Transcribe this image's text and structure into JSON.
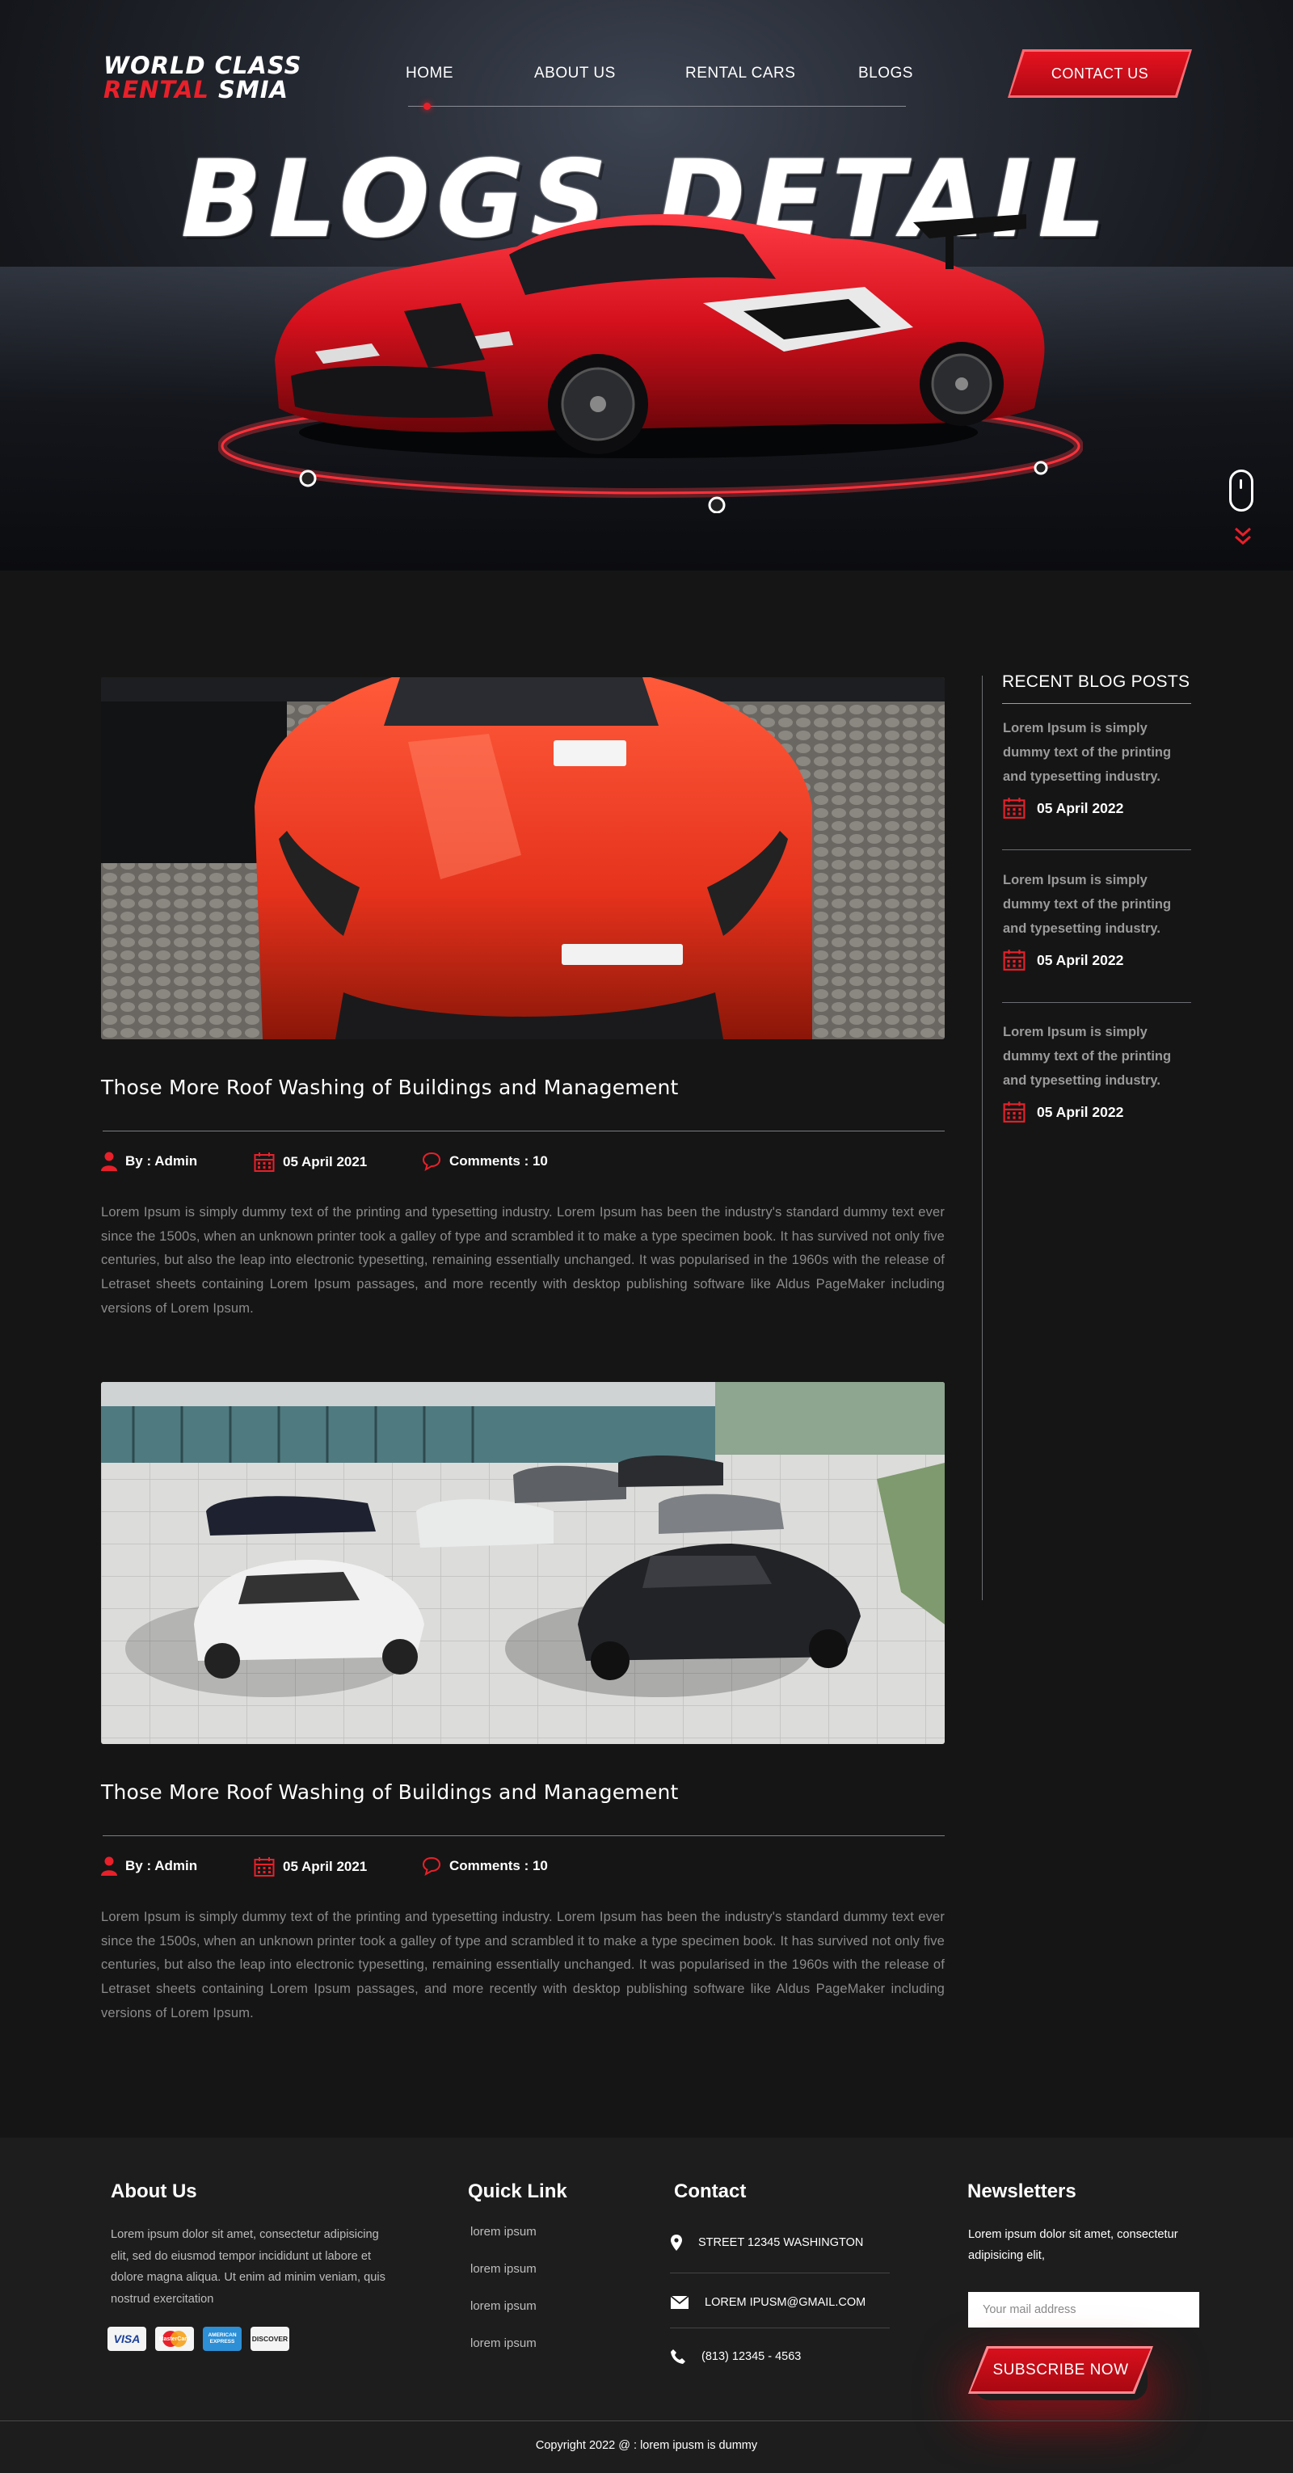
{
  "brand": {
    "line1": "WORLD CLASS",
    "line2_red": "RENTAL",
    "line2_white": "SMIA"
  },
  "nav": {
    "items": [
      "HOME",
      "ABOUT US",
      "RENTAL CARS",
      "BLOGS"
    ],
    "active": "HOME"
  },
  "header": {
    "contact_label": "CONTACT US"
  },
  "hero": {
    "title": "BLOGS DETAIL"
  },
  "posts": [
    {
      "title": "Those More Roof Washing of Buildings and Management",
      "author": "By : Admin",
      "date": "05 April 2021",
      "comments": "Comments : 10",
      "body": "Lorem Ipsum is simply dummy text of the printing and typesetting industry. Lorem Ipsum has been the industry's standard dummy text ever since the 1500s, when an unknown printer took a galley of type and scrambled it to make a type specimen book. It has survived not only five centuries, but also the leap into electronic typesetting, remaining essentially unchanged. It was popularised in the 1960s with the release of Letraset sheets containing Lorem Ipsum passages, and more recently with desktop publishing software like Aldus PageMaker including versions of Lorem Ipsum."
    },
    {
      "title": "Those More Roof Washing of Buildings and Management",
      "author": "By : Admin",
      "date": "05 April 2021",
      "comments": "Comments : 10",
      "body": "Lorem Ipsum is simply dummy text of the printing and typesetting industry. Lorem Ipsum has been the industry's standard dummy text ever since the 1500s, when an unknown printer took a galley of type and scrambled it to make a type specimen book. It has survived not only five centuries, but also the leap into electronic typesetting, remaining essentially unchanged. It was popularised in the 1960s with the release of Letraset sheets containing Lorem Ipsum passages, and more recently with desktop publishing software like Aldus PageMaker including versions of Lorem Ipsum."
    }
  ],
  "sidebar": {
    "title": "RECENT BLOG POSTS",
    "posts": [
      {
        "text": "Lorem Ipsum is simply dummy text of the printing and typesetting industry.",
        "date": "05 April 2022"
      },
      {
        "text": "Lorem Ipsum is simply dummy text of the printing and typesetting industry.",
        "date": "05 April 2022"
      },
      {
        "text": "Lorem Ipsum is simply dummy text of the printing and typesetting industry.",
        "date": "05 April 2022"
      }
    ]
  },
  "footer": {
    "about": {
      "heading": "About Us",
      "text": "Lorem ipsum dolor sit amet, consectetur adipisicing elit, sed do eiusmod tempor incididunt ut labore et dolore magna aliqua. Ut enim ad minim veniam, quis nostrud exercitation",
      "cards": [
        "VISA",
        "MasterCard",
        "AMERICAN EXPRESS",
        "DISCOVER"
      ]
    },
    "quick": {
      "heading": "Quick Link",
      "links": [
        "lorem ipsum",
        "lorem ipsum",
        "lorem ipsum",
        "lorem ipsum"
      ]
    },
    "contact": {
      "heading": "Contact",
      "address": "STREET 12345 WASHINGTON",
      "email": "LOREM IPUSM@GMAIL.COM",
      "phone": "(813) 12345 - 4563"
    },
    "newsletter": {
      "heading": "Newsletters",
      "text": "Lorem ipsum dolor sit amet, consectetur adipisicing elit,",
      "placeholder": "Your mail address",
      "button": "SUBSCRIBE NOW"
    },
    "copyright": "Copyright 2022  @ : lorem ipusm is dummy"
  },
  "colors": {
    "accent": "#e8202a",
    "background": "#151515",
    "footer": "#1d1d1d",
    "muted_text": "#8b8b8b"
  },
  "icons": [
    "user-icon",
    "calendar-icon",
    "comment-icon",
    "location-pin-icon",
    "envelope-icon",
    "phone-icon",
    "mouse-scroll-icon",
    "chevron-down-icon"
  ]
}
